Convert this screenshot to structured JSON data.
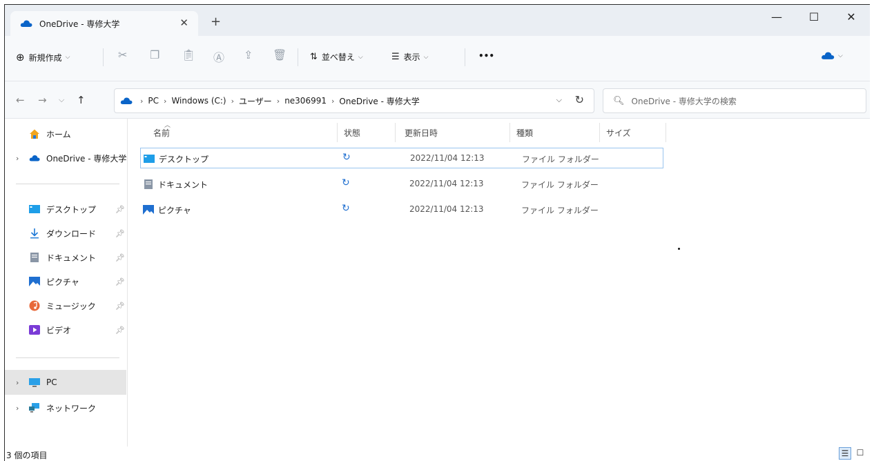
{
  "window": {
    "tab_title": "OneDrive - 専修大学",
    "tab_close": "✕",
    "new_tab": "+",
    "minimize": "—",
    "maximize": "☐",
    "close": "✕"
  },
  "toolbar": {
    "new_label": "新規作成",
    "sort_label": "並べ替え",
    "view_label": "表示",
    "more": "•••"
  },
  "address": {
    "crumbs": [
      "PC",
      "Windows (C:)",
      "ユーザー",
      "ne306991",
      "OneDrive - 専修大学"
    ],
    "search_placeholder": "OneDrive - 専修大学の検索"
  },
  "sidebar": {
    "home": "ホーム",
    "onedrive": "OneDrive - 専修大学",
    "quick_access": [
      {
        "label": "デスクトップ",
        "icon": "desktop-folder-icon"
      },
      {
        "label": "ダウンロード",
        "icon": "download-icon"
      },
      {
        "label": "ドキュメント",
        "icon": "document-icon"
      },
      {
        "label": "ピクチャ",
        "icon": "pictures-icon"
      },
      {
        "label": "ミュージック",
        "icon": "music-icon"
      },
      {
        "label": "ビデオ",
        "icon": "video-icon"
      }
    ],
    "pc": "PC",
    "network": "ネットワーク"
  },
  "columns": {
    "name": "名前",
    "status": "状態",
    "modified": "更新日時",
    "type": "種類",
    "size": "サイズ"
  },
  "files": [
    {
      "name": "デスクトップ",
      "modified": "2022/11/04 12:13",
      "type": "ファイル フォルダー",
      "icon": "desktop-folder-icon"
    },
    {
      "name": "ドキュメント",
      "modified": "2022/11/04 12:13",
      "type": "ファイル フォルダー",
      "icon": "document-icon"
    },
    {
      "name": "ピクチャ",
      "modified": "2022/11/04 12:13",
      "type": "ファイル フォルダー",
      "icon": "pictures-icon"
    }
  ],
  "status": {
    "item_count": "3 個の項目"
  },
  "colors": {
    "accent": "#1f6fd0",
    "onedrive_blue": "#0a64c8",
    "selection_border": "#99c4ef"
  }
}
